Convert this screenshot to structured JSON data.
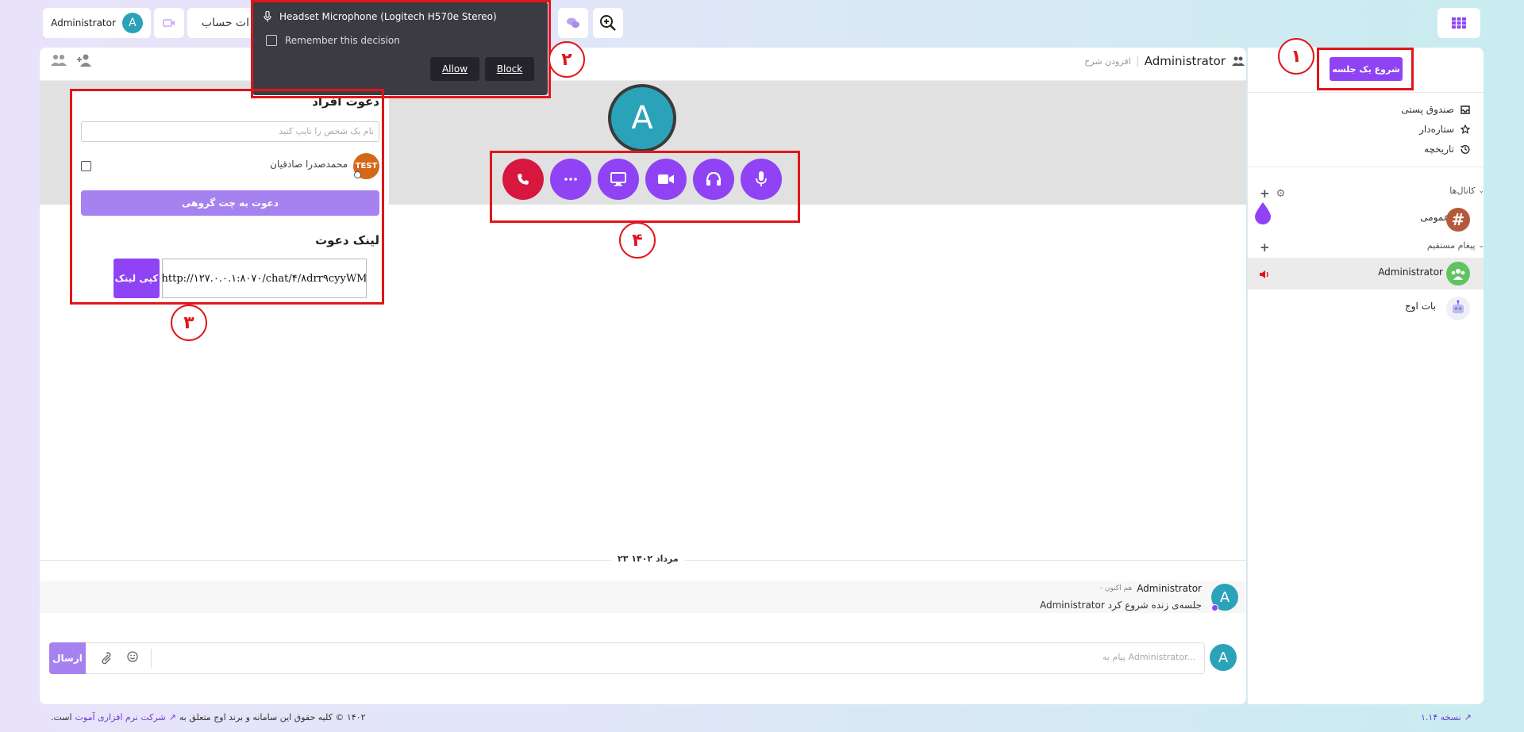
{
  "topbar": {
    "user_name": "Administrator",
    "user_initial": "A",
    "account_label": "ات حساب"
  },
  "permission_popup": {
    "device": "Headset Microphone (Logitech H570e Stereo)",
    "remember": "Remember this decision",
    "allow": "Allow",
    "block": "Block"
  },
  "sidebar": {
    "start_meeting": "شروع یک جلسه",
    "links": [
      {
        "label": "صندوق پستی",
        "icon": "inbox-icon"
      },
      {
        "label": "ستاره‌دار",
        "icon": "star-icon"
      },
      {
        "label": "تاریخچه",
        "icon": "history-icon"
      }
    ],
    "channels_heading": "کانال‌ها",
    "channels": [
      {
        "label": "عمومی",
        "icon": "hash-icon"
      }
    ],
    "dm_heading": "پیغام مستقیم",
    "dms": [
      {
        "label": "Administrator",
        "icon": "group-avatar-icon",
        "active": true
      },
      {
        "label": "بات اوج",
        "icon": "bot-avatar-icon",
        "active": false
      }
    ]
  },
  "chat_header": {
    "title": "Administrator",
    "add_description": "افزودن شرح"
  },
  "call": {
    "participant_initial": "A"
  },
  "invite": {
    "title": "دعوت افراد",
    "search_placeholder": "نام یک شخص را تایپ کنید",
    "candidate_name": "محمدصدرا صادقیان",
    "candidate_badge": "TEST",
    "invite_button": "دعوت به چت گروهی",
    "link_title": "لینک دعوت",
    "link_value": "http://۱۲۷.۰.۰.۱:۸۰۷۰/chat/۴/۸drr۹cyyWM",
    "copy_button": "کپی لینک"
  },
  "timeline": {
    "date": "۲۳ مرداد ۱۴۰۲",
    "message_author": "Administrator",
    "message_time": "- هم اکنون",
    "message_text": "Administrator جلسه‌ی زنده شروع کرد",
    "author_initial": "A"
  },
  "composer": {
    "placeholder": "پیام به Administrator...",
    "send": "ارسال",
    "user_initial": "A"
  },
  "footer": {
    "version": "نسخه ۱.۱۴",
    "copyright_prefix": "۱۴۰۲ © کلیه حقوق این سامانه و برند اوج متعلق به",
    "company": "شرکت نرم افزاری آموت",
    "copyright_suffix": "است."
  },
  "annotations": [
    "۱",
    "۲",
    "۳",
    "۴"
  ],
  "colors": {
    "accent": "#8f43f5",
    "end_call": "#d8173f",
    "annotation": "#e0161b"
  }
}
